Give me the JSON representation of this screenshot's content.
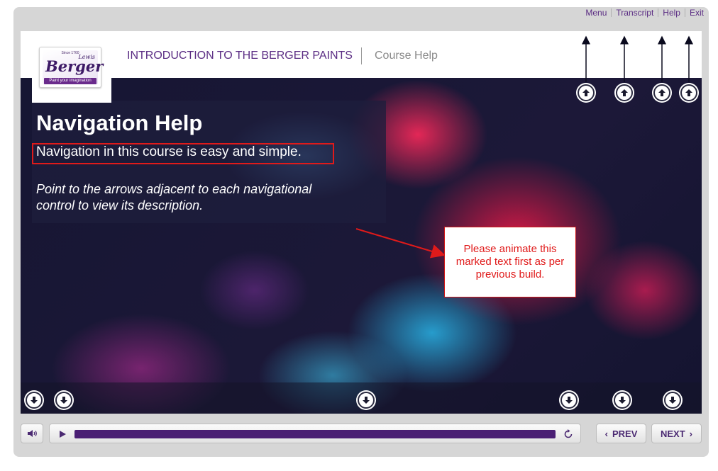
{
  "top_nav": {
    "menu": "Menu",
    "transcript": "Transcript",
    "help": "Help",
    "exit": "Exit"
  },
  "header": {
    "logo": {
      "brand": "Berger",
      "sub": "Lewis",
      "since": "Since 1760",
      "tagline": "Paint your imagination"
    },
    "course_title": "INTRODUCTION TO THE BERGER PAINTS",
    "page_title": "Course Help"
  },
  "content": {
    "heading": "Navigation Help",
    "lead": "Navigation in this course is easy and simple.",
    "description": "Point to the arrows adjacent to each navigational control to view its description."
  },
  "annotation": {
    "note": "Please animate this marked text first as per previous build.",
    "color": "#e01a1a"
  },
  "player": {
    "progress": 1.0,
    "prev_label": "PREV",
    "next_label": "NEXT",
    "icons": {
      "volume": "speaker-icon",
      "play": "play-icon",
      "replay": "replay-icon",
      "prev": "chevron-left-icon",
      "next": "chevron-right-icon"
    }
  },
  "colors": {
    "accent": "#5b2d84",
    "progress_fill": "#4a1e74",
    "frame": "#d6d6d6"
  }
}
